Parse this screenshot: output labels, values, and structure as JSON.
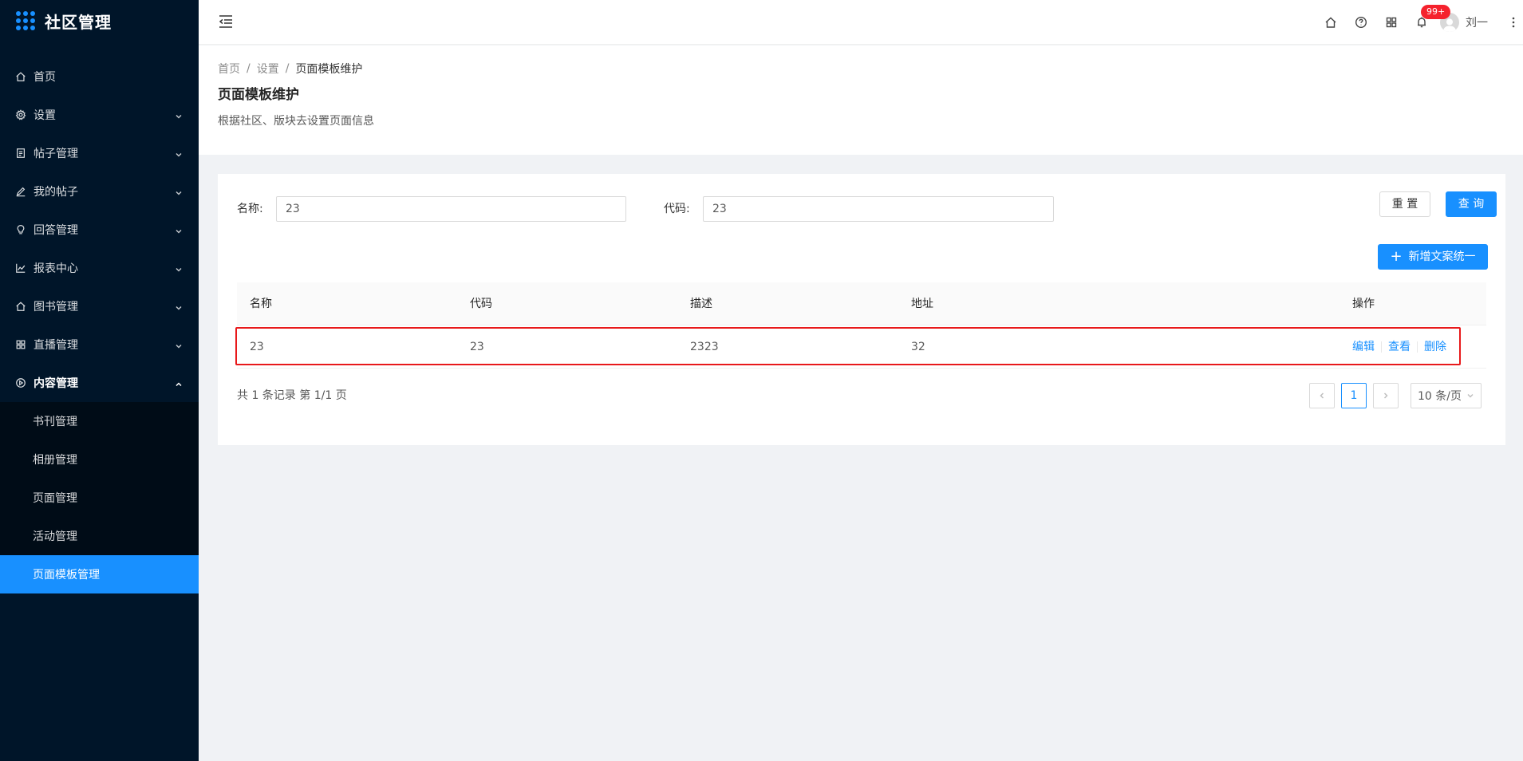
{
  "app": {
    "title": "社区管理"
  },
  "sidebar": {
    "items": [
      {
        "label": "首页",
        "icon": "home-icon",
        "has_arrow": false
      },
      {
        "label": "设置",
        "icon": "gear-icon",
        "has_arrow": true
      },
      {
        "label": "帖子管理",
        "icon": "file-icon",
        "has_arrow": true
      },
      {
        "label": "我的帖子",
        "icon": "edit-icon",
        "has_arrow": true
      },
      {
        "label": "回答管理",
        "icon": "bulb-icon",
        "has_arrow": true
      },
      {
        "label": "报表中心",
        "icon": "line-chart-icon",
        "has_arrow": true
      },
      {
        "label": "图书管理",
        "icon": "home-icon",
        "has_arrow": true
      },
      {
        "label": "直播管理",
        "icon": "grid-icon",
        "has_arrow": true
      },
      {
        "label": "内容管理",
        "icon": "play-circle-icon",
        "has_arrow": true,
        "open": true
      }
    ],
    "subitems": [
      {
        "label": "书刊管理"
      },
      {
        "label": "相册管理"
      },
      {
        "label": "页面管理"
      },
      {
        "label": "活动管理"
      },
      {
        "label": "页面模板管理",
        "active": true
      }
    ]
  },
  "header": {
    "badge": "99+",
    "user_name": "刘一",
    "icons": [
      "home-icon",
      "question-icon",
      "apps-icon",
      "bell-icon",
      "more-icon"
    ]
  },
  "breadcrumb": {
    "items": [
      "首页",
      "设置",
      "页面模板维护"
    ],
    "separator": "/"
  },
  "page": {
    "title": "页面模板维护",
    "description": "根据社区、版块去设置页面信息"
  },
  "filter": {
    "name_label": "名称:",
    "name_value": "23",
    "code_label": "代码:",
    "code_value": "23",
    "reset_label": "重 置",
    "query_label": "查 询",
    "add_label": "新增文案统一"
  },
  "table": {
    "columns": [
      "名称",
      "代码",
      "描述",
      "地址",
      "操作"
    ],
    "rows": [
      {
        "name": "23",
        "code": "23",
        "desc": "2323",
        "address": "32",
        "ops": [
          "编辑",
          "查看",
          "删除"
        ]
      }
    ]
  },
  "pagination": {
    "summary": "共 1 条记录 第 1/1 页",
    "current": "1",
    "page_size": "10 条/页"
  },
  "colors": {
    "primary": "#1890ff",
    "sidebar_bg": "#001529",
    "highlight": "#e8191b",
    "badge": "#f5222d"
  }
}
